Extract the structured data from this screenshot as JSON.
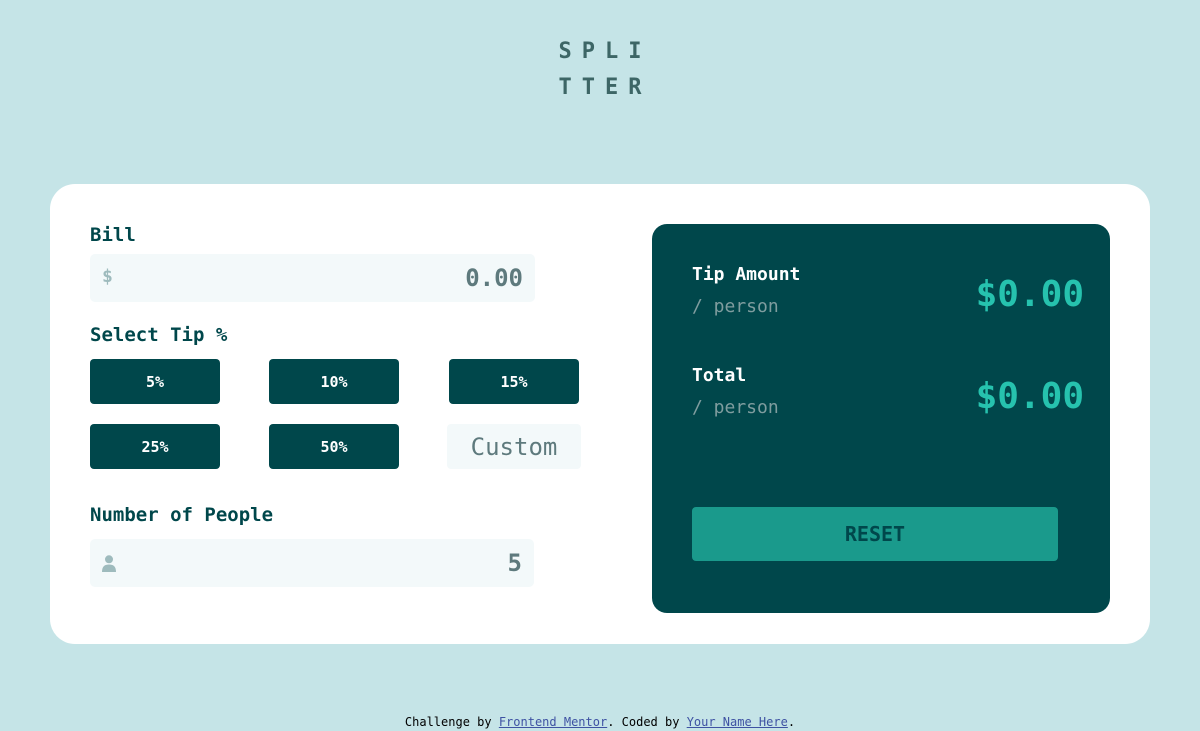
{
  "app": {
    "logo_line1": "SPLI",
    "logo_line2": "TTER"
  },
  "bill": {
    "label": "Bill",
    "placeholder": "0.00",
    "icon": "dollar-icon",
    "icon_glyph": "$"
  },
  "tip": {
    "label": "Select Tip %",
    "options": [
      "5%",
      "10%",
      "15%",
      "25%",
      "50%"
    ],
    "custom_placeholder": "Custom"
  },
  "people": {
    "label": "Number of People",
    "value": "5",
    "icon": "person-icon"
  },
  "results": {
    "tip_label": "Tip Amount",
    "tip_sub": "/ person",
    "tip_value": "$0.00",
    "total_label": "Total",
    "total_sub": "/ person",
    "total_value": "$0.00",
    "reset_label": "RESET"
  },
  "footer": {
    "prefix": "Challenge by ",
    "link1": "Frontend Mentor",
    "middle": ". Coded by ",
    "link2": "Your Name Here",
    "suffix": "."
  },
  "colors": {
    "background": "#c5e4e7",
    "dark_cyan": "#00474b",
    "strong_cyan": "#26c2ae",
    "light_input": "#f3f9fa"
  }
}
